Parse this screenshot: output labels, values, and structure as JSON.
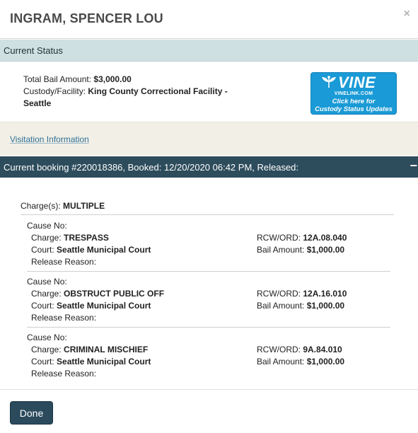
{
  "header": {
    "title": "INGRAM, SPENCER LOU",
    "close_label": "×"
  },
  "status": {
    "section_title": "Current Status",
    "bail_label": "Total Bail Amount:",
    "bail_value": "$3,000.00",
    "custody_label": "Custody/Facility:",
    "custody_value": "King County Correctional Facility - Seattle"
  },
  "vine": {
    "logo_text": "VINE",
    "site": "VINELINK.COM",
    "cta_line1": "Click here for",
    "cta_line2": "Custody Status Updates",
    "color": "#1a9ad6"
  },
  "visitation": {
    "link_label": "Visitation Information"
  },
  "booking": {
    "header_text": "Current booking #220018386, Booked: 12/20/2020 06:42 PM, Released:",
    "collapse_label": "−",
    "charges_label": "Charge(s):",
    "charges_value": "MULTIPLE",
    "charges": [
      {
        "cause_label": "Cause No:",
        "charge_label": "Charge:",
        "charge_value": "TRESPASS",
        "court_label": "Court:",
        "court_value": "Seattle Municipal Court",
        "release_label": "Release Reason:",
        "rcw_label": "RCW/ORD:",
        "rcw_value": "12A.08.040",
        "bail_label": "Bail Amount:",
        "bail_value": "$1,000.00"
      },
      {
        "cause_label": "Cause No:",
        "charge_label": "Charge:",
        "charge_value": "OBSTRUCT PUBLIC OFF",
        "court_label": "Court:",
        "court_value": "Seattle Municipal Court",
        "release_label": "Release Reason:",
        "rcw_label": "RCW/ORD:",
        "rcw_value": "12A.16.010",
        "bail_label": "Bail Amount:",
        "bail_value": "$1,000.00"
      },
      {
        "cause_label": "Cause No:",
        "charge_label": "Charge:",
        "charge_value": "CRIMINAL MISCHIEF",
        "court_label": "Court:",
        "court_value": "Seattle Municipal Court",
        "release_label": "Release Reason:",
        "rcw_label": "RCW/ORD:",
        "rcw_value": "9A.84.010",
        "bail_label": "Bail Amount:",
        "bail_value": "$1,000.00"
      }
    ]
  },
  "footer": {
    "done_label": "Done"
  }
}
